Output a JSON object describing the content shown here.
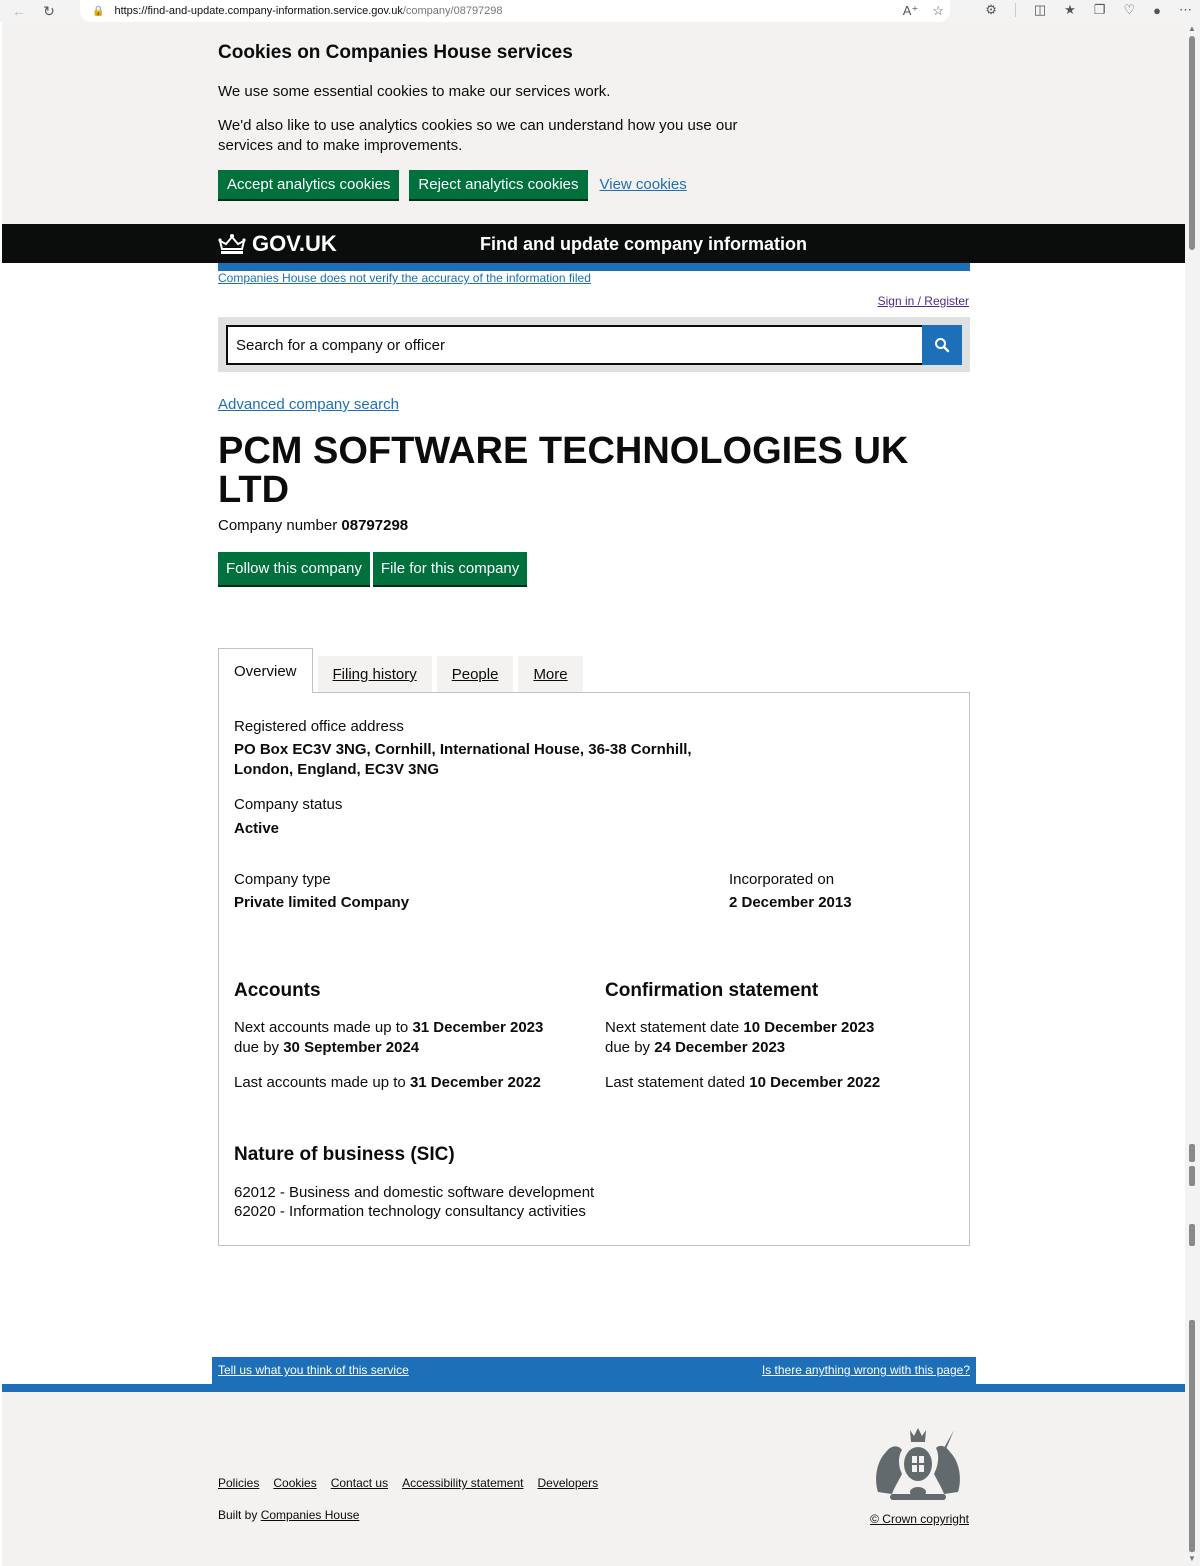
{
  "browser": {
    "url_host": "https://find-and-update.company-information.service.gov.uk",
    "url_path": "/company/08797298"
  },
  "cookies": {
    "title": "Cookies on Companies House services",
    "text1": "We use some essential cookies to make our services work.",
    "text2": "We'd also like to use analytics cookies so we can understand how you use our services and to make improvements.",
    "accept_label": "Accept analytics cookies",
    "reject_label": "Reject analytics cookies",
    "view_label": "View cookies"
  },
  "header": {
    "logo_text": "GOV.UK",
    "service_name": "Find and update company information"
  },
  "phase_banner": {
    "text": "Companies House does not verify the accuracy of the information filed"
  },
  "account": {
    "signin_label": "Sign in / Register"
  },
  "search": {
    "placeholder": "Search for a company or officer"
  },
  "advanced_search_label": "Advanced company search",
  "company": {
    "name": "PCM SOFTWARE TECHNOLOGIES UK LTD",
    "number_label": "Company number",
    "number": "08797298",
    "follow_label": "Follow this company",
    "file_label": "File for this company"
  },
  "tabs": [
    {
      "label": "Overview"
    },
    {
      "label": "Filing history"
    },
    {
      "label": "People"
    },
    {
      "label": "More"
    }
  ],
  "overview": {
    "registered_office_label": "Registered office address",
    "registered_office_line1": "PO Box EC3V 3NG, Cornhill, International House, 36-38 Cornhill,",
    "registered_office_line2": "London, England, EC3V 3NG",
    "status_label": "Company status",
    "status": "Active",
    "type_label": "Company type",
    "type": "Private limited Company",
    "incorporated_label": "Incorporated on",
    "incorporated": "2 December 2013",
    "accounts": {
      "heading": "Accounts",
      "next_prefix": "Next accounts made up to",
      "next_date": "31 December 2023",
      "due_prefix": "due by",
      "due_date": "30 September 2024",
      "last_prefix": "Last accounts made up to",
      "last_date": "31 December 2022"
    },
    "confirmation": {
      "heading": "Confirmation statement",
      "next_prefix": "Next statement date",
      "next_date": "10 December 2023",
      "due_prefix": "due by",
      "due_date": "24 December 2023",
      "last_prefix": "Last statement dated",
      "last_date": "10 December 2022"
    },
    "sic": {
      "heading": "Nature of business (SIC)",
      "items": [
        "62012 - Business and domestic software development",
        "62020 - Information technology consultancy activities"
      ]
    }
  },
  "feedback": {
    "left_label": "Tell us what you think of this service",
    "right_label": "Is there anything wrong with this page?"
  },
  "footer": {
    "links": [
      "Policies",
      "Cookies",
      "Contact us",
      "Accessibility statement",
      "Developers"
    ],
    "built_by_prefix": "Built by",
    "built_by_link": "Companies House",
    "copyright": "© Crown copyright"
  },
  "colors": {
    "govuk_green": "#00703c",
    "govuk_blue": "#1d70b8",
    "header_black": "#0b0c0c"
  }
}
